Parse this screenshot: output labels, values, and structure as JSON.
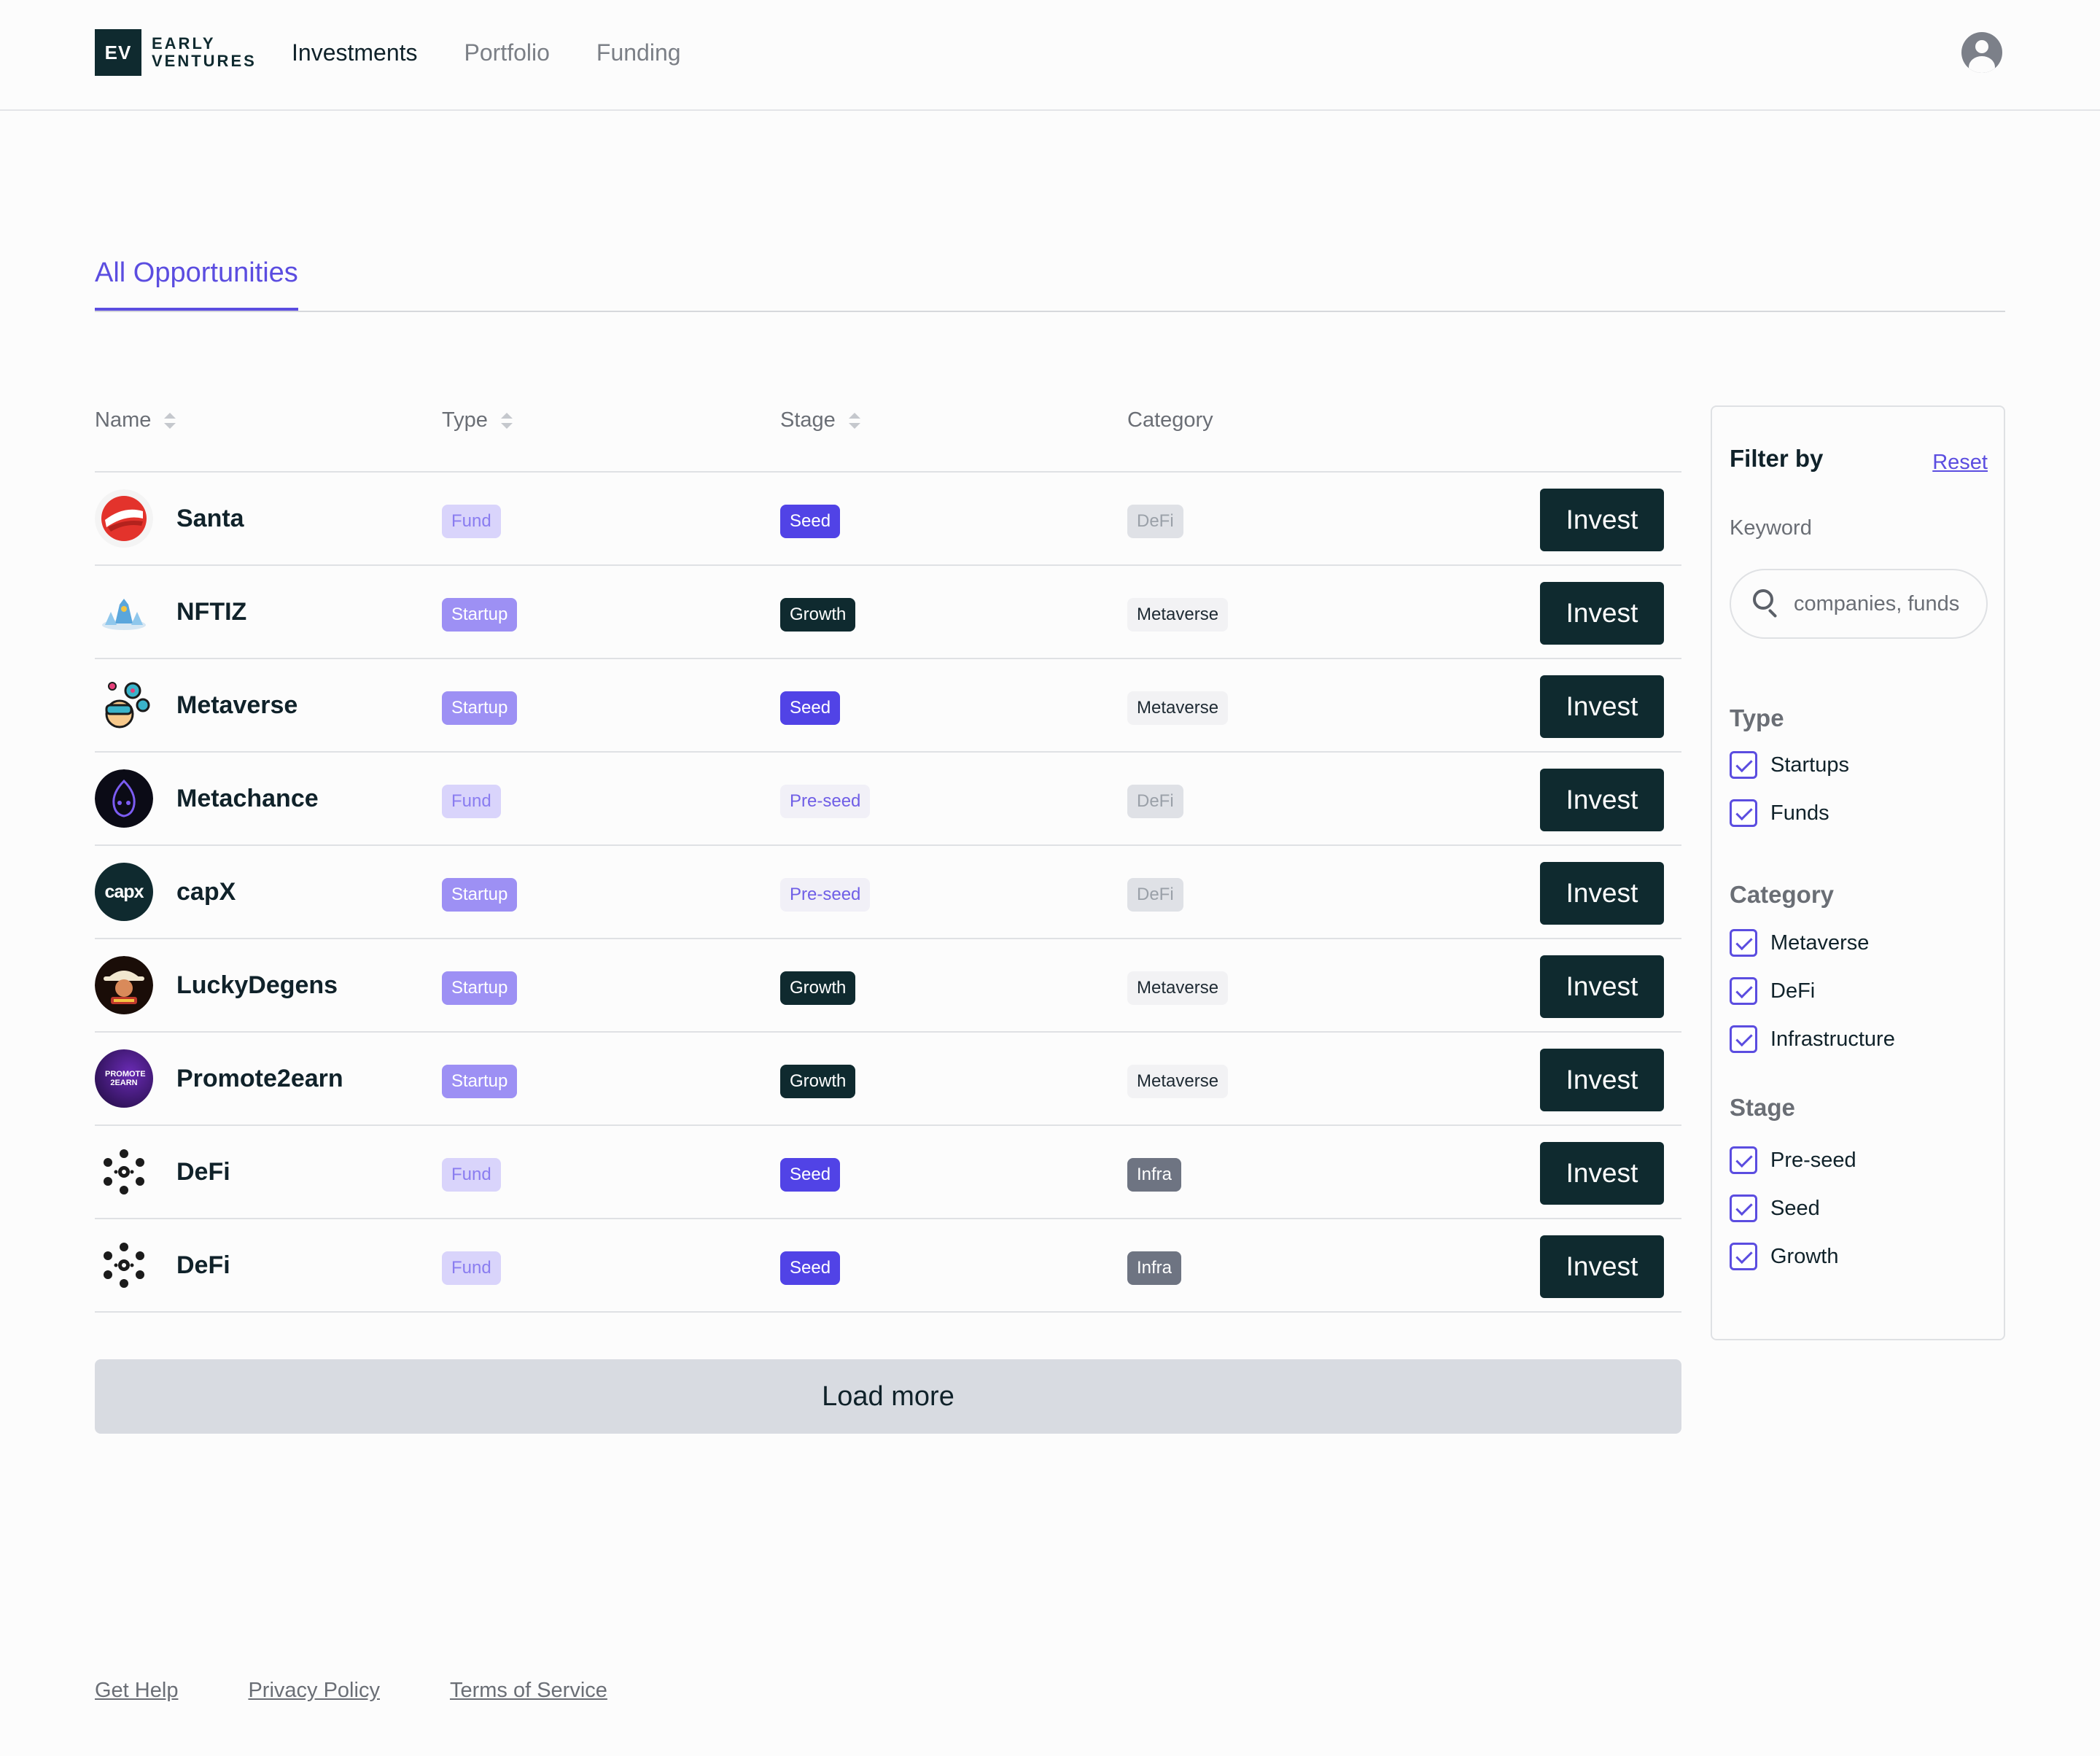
{
  "brand": {
    "mark": "EV",
    "line1": "EARLY",
    "line2": "VENTURES"
  },
  "nav": {
    "items": [
      {
        "label": "Investments",
        "active": true
      },
      {
        "label": "Portfolio",
        "active": false
      },
      {
        "label": "Funding",
        "active": false
      }
    ]
  },
  "user": {
    "icon": "user-avatar-icon"
  },
  "tabs": {
    "active_label": "All Opportunities"
  },
  "table": {
    "headers": {
      "name": "Name",
      "type": "Type",
      "stage": "Stage",
      "category": "Category"
    },
    "invest_label": "Invest",
    "rows": [
      {
        "name": "Santa",
        "type": "Fund",
        "stage": "Seed",
        "category": "DeFi"
      },
      {
        "name": "NFTIZ",
        "type": "Startup",
        "stage": "Growth",
        "category": "Metaverse"
      },
      {
        "name": "Metaverse",
        "type": "Startup",
        "stage": "Seed",
        "category": "Metaverse"
      },
      {
        "name": "Metachance",
        "type": "Fund",
        "stage": "Pre-seed",
        "category": "DeFi"
      },
      {
        "name": "capX",
        "type": "Startup",
        "stage": "Pre-seed",
        "category": "DeFi",
        "logo_text": "capx"
      },
      {
        "name": "LuckyDegens",
        "type": "Startup",
        "stage": "Growth",
        "category": "Metaverse"
      },
      {
        "name": "Promote2earn",
        "type": "Startup",
        "stage": "Growth",
        "category": "Metaverse",
        "logo_text": "PROMOTE 2EARN"
      },
      {
        "name": "DeFi",
        "type": "Fund",
        "stage": "Seed",
        "category": "Infra"
      },
      {
        "name": "DeFi",
        "type": "Fund",
        "stage": "Seed",
        "category": "Infra"
      }
    ],
    "load_more_label": "Load more"
  },
  "filter": {
    "title": "Filter by",
    "reset_label": "Reset",
    "keyword_label": "Keyword",
    "search_placeholder": "companies, funds",
    "search_value": "",
    "groups": {
      "type": {
        "title": "Type",
        "options": [
          "Startups",
          "Funds"
        ]
      },
      "category": {
        "title": "Category",
        "options": [
          "Metaverse",
          "DeFi",
          "Infrastructure"
        ]
      },
      "stage": {
        "title": "Stage",
        "options": [
          "Pre-seed",
          "Seed",
          "Growth"
        ]
      }
    }
  },
  "footer": {
    "links": [
      "Get Help",
      "Privacy Policy",
      "Terms of Service"
    ]
  },
  "colors": {
    "accent": "#5b4de0",
    "dark": "#0f2a2f",
    "startup_badge": "#9d90f4",
    "fund_badge": "#d9d4fb",
    "infra_badge": "#6e7482",
    "load_more_bg": "#d8dbe1"
  }
}
